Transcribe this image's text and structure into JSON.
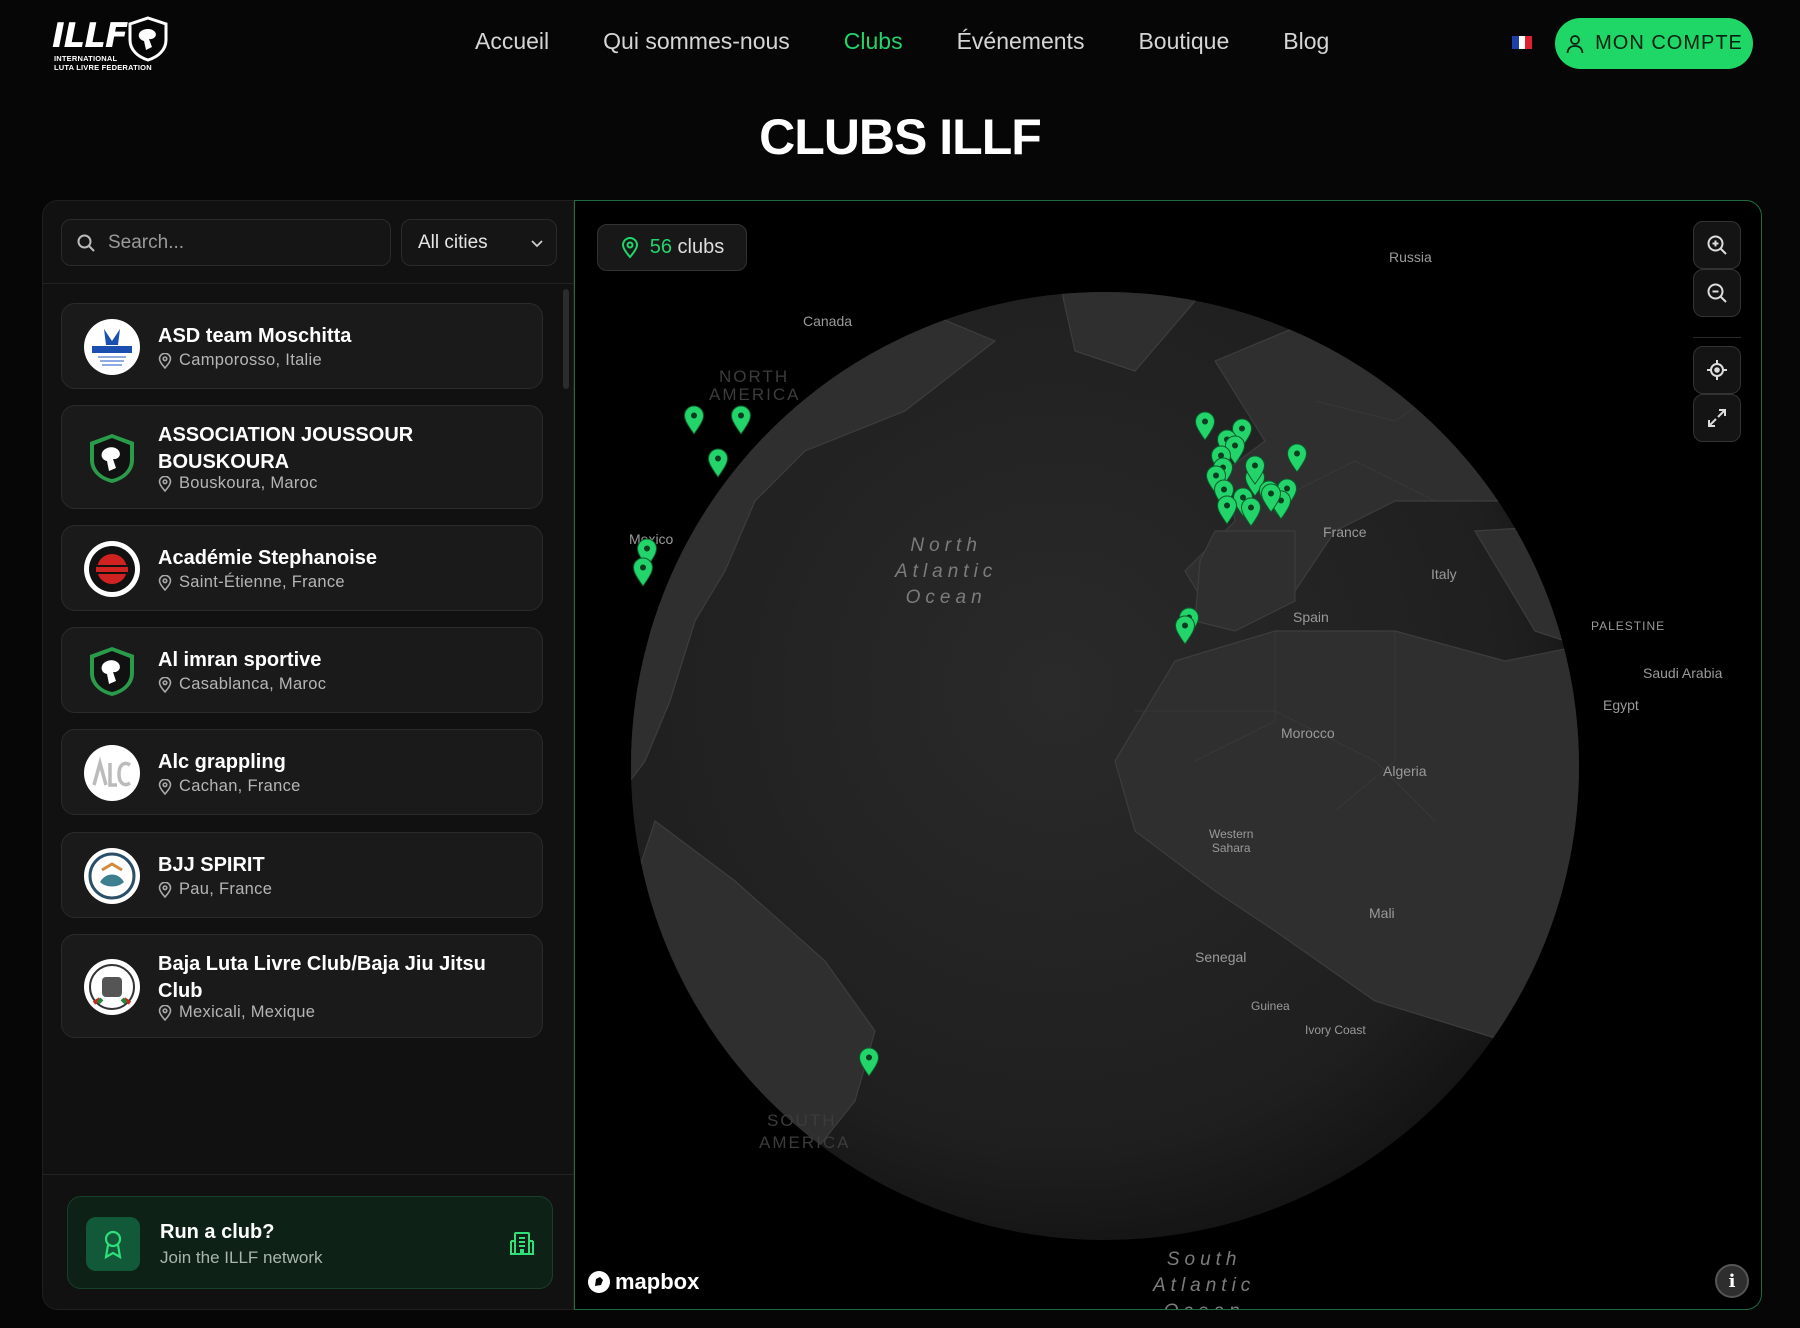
{
  "header": {
    "logo_text": "ILLF",
    "logo_sub_1": "INTERNATIONAL",
    "logo_sub_2": "LUTA LIVRE FEDERATION",
    "nav": [
      {
        "label": "Accueil",
        "active": false
      },
      {
        "label": "Qui sommes-nous",
        "active": false
      },
      {
        "label": "Clubs",
        "active": true
      },
      {
        "label": "Événements",
        "active": false
      },
      {
        "label": "Boutique",
        "active": false
      },
      {
        "label": "Blog",
        "active": false
      }
    ],
    "account_label": "MON COMPTE",
    "flag_colors": [
      "#1f3fa8",
      "#ffffff",
      "#e0202e"
    ]
  },
  "page_title": "CLUBS ILLF",
  "sidebar": {
    "search_placeholder": "Search...",
    "city_filter": "All cities",
    "clubs": [
      {
        "name": "ASD team Moschitta",
        "location": "Camporosso, Italie",
        "logo": "team-logo"
      },
      {
        "name": "ASSOCIATION JOUSSOUR BOUSKOURA",
        "location": "Bouskoura, Maroc",
        "logo": "illf-shield"
      },
      {
        "name": "Académie Stephanoise",
        "location": "Saint-Étienne, France",
        "logo": "academie-logo"
      },
      {
        "name": "Al imran sportive",
        "location": "Casablanca, Maroc",
        "logo": "illf-shield"
      },
      {
        "name": "Alc grappling",
        "location": "Cachan, France",
        "logo": "alc-logo"
      },
      {
        "name": "BJJ SPIRIT",
        "location": "Pau, France",
        "logo": "bjj-logo"
      },
      {
        "name": "Baja Luta Livre Club/Baja Jiu Jitsu Club",
        "location": "Mexicali, Mexique",
        "logo": "baja-logo"
      }
    ],
    "cta_title": "Run a club?",
    "cta_subtitle": "Join the ILLF network"
  },
  "map": {
    "club_count": "56",
    "club_count_suffix": "clubs",
    "attribution": "mapbox",
    "accent_color": "#22d46a",
    "labels": {
      "russia": "Russia",
      "canada": "Canada",
      "north_america_1": "NORTH",
      "north_america_2": "AMERICA",
      "mexico": "Mexico",
      "north_atlantic": "North",
      "north_atlantic_2": "Atlantic",
      "north_atlantic_3": "Ocean",
      "france": "France",
      "italy": "Italy",
      "spain": "Spain",
      "palestine": "PALESTINE",
      "saudi_arabia": "Saudi Arabia",
      "egypt": "Egypt",
      "morocco": "Morocco",
      "algeria": "Algeria",
      "western_sahara_1": "Western",
      "western_sahara_2": "Sahara",
      "mali": "Mali",
      "senegal": "Senegal",
      "guinea": "Guinea",
      "ivory_coast": "Ivory Coast",
      "south_america_1": "SOUTH",
      "south_america_2": "AMERICA",
      "south_atlantic_1": "South",
      "south_atlantic_2": "Atlantic",
      "south_atlantic_3": "Ocean"
    }
  }
}
